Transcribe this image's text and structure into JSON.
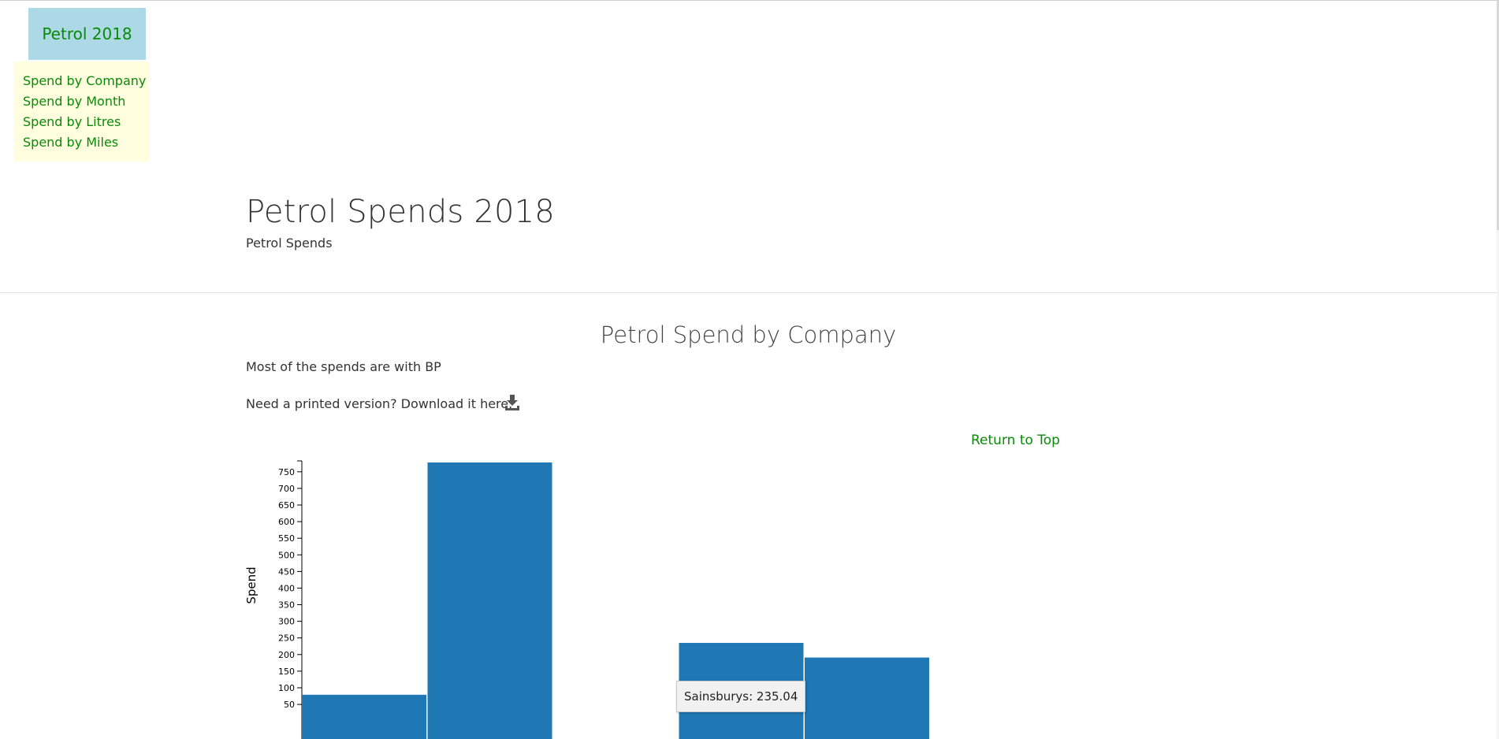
{
  "brand": "Petrol 2018",
  "nav": {
    "items": [
      "Spend by Company",
      "Spend by Month",
      "Spend by Litres",
      "Spend by Miles"
    ]
  },
  "header": {
    "title": "Petrol Spends 2018",
    "subtitle": "Petrol Spends"
  },
  "section": {
    "title": "Petrol Spend by Company",
    "lead": "Most of the spends are with BP",
    "download_text": "Need a printed version? Download it here.",
    "download_icon": "download-icon",
    "return_link": "Return to Top"
  },
  "tooltip": "Sainsburys: 235.04",
  "chart_data": {
    "type": "bar",
    "ylabel": "Spend",
    "categories": [
      "",
      "",
      "",
      "Sainsburys",
      ""
    ],
    "values": [
      79,
      778,
      null,
      235.04,
      191
    ],
    "ylim_visible": [
      35,
      778
    ],
    "yticks": [
      50,
      100,
      150,
      200,
      250,
      300,
      350,
      400,
      450,
      500,
      550,
      600,
      650,
      700,
      750
    ],
    "bar_color": "#1f77b4",
    "grid": false
  },
  "colors": {
    "link_green": "#098a09",
    "brand_bg": "#add8e6",
    "nav_bg": "#ffffe0",
    "bar": "#1f77b4"
  }
}
